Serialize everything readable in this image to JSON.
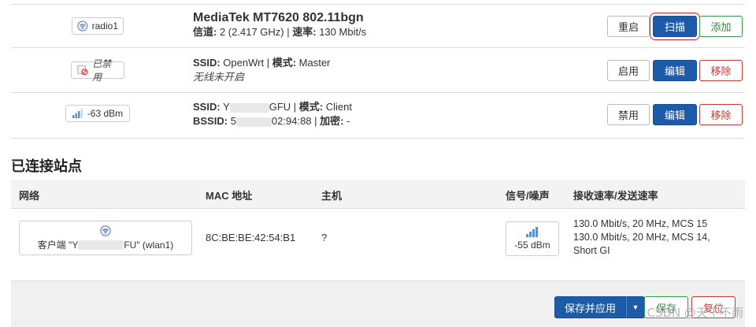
{
  "radio": {
    "badge": "radio1",
    "title": "MediaTek MT7620 802.11bgn",
    "channel_label": "信道:",
    "channel_value": "2 (2.417 GHz)",
    "rate_label": "速率:",
    "rate_value": "130 Mbit/s",
    "buttons": {
      "restart": "重启",
      "scan": "扫描",
      "add": "添加"
    }
  },
  "iface1": {
    "badge": "已禁用",
    "ssid_label": "SSID:",
    "ssid": "OpenWrt",
    "mode_label": "模式:",
    "mode": "Master",
    "note": "无线未开启",
    "buttons": {
      "enable": "启用",
      "edit": "编辑",
      "remove": "移除"
    }
  },
  "iface2": {
    "badge": "-63 dBm",
    "ssid_label": "SSID:",
    "ssid_prefix": "Y",
    "ssid_suffix": "GFU",
    "mode_label": "模式:",
    "mode": "Client",
    "bssid_label": "BSSID:",
    "bssid_prefix": "5",
    "bssid_suffix": "02:94:88",
    "enc_label": "加密:",
    "enc": "-",
    "buttons": {
      "disable": "禁用",
      "edit": "编辑",
      "remove": "移除"
    }
  },
  "stations": {
    "heading": "已连接站点",
    "columns": {
      "network": "网络",
      "mac": "MAC 地址",
      "host": "主机",
      "signal": "信号/噪声",
      "rate": "接收速率/发送速率"
    },
    "row": {
      "network_prefix": "客户端 \"Y",
      "network_suffix": "FU\" (wlan1)",
      "mac": "8C:BE:BE:42:54:B1",
      "host": "?",
      "signal": "-55 dBm",
      "rate_rx": "130.0 Mbit/s, 20 MHz, MCS 15",
      "rate_tx": "130.0 Mbit/s, 20 MHz, MCS 14,",
      "rate_tx2": "Short GI"
    }
  },
  "footer": {
    "save_apply": "保存并应用",
    "save": "保存",
    "reset": "复位"
  },
  "watermark": "CSDN @天下不雨",
  "icons": [
    "wifi-radio-icon",
    "wifi-disabled-icon",
    "signal-bars-icon",
    "caret-down-icon"
  ]
}
